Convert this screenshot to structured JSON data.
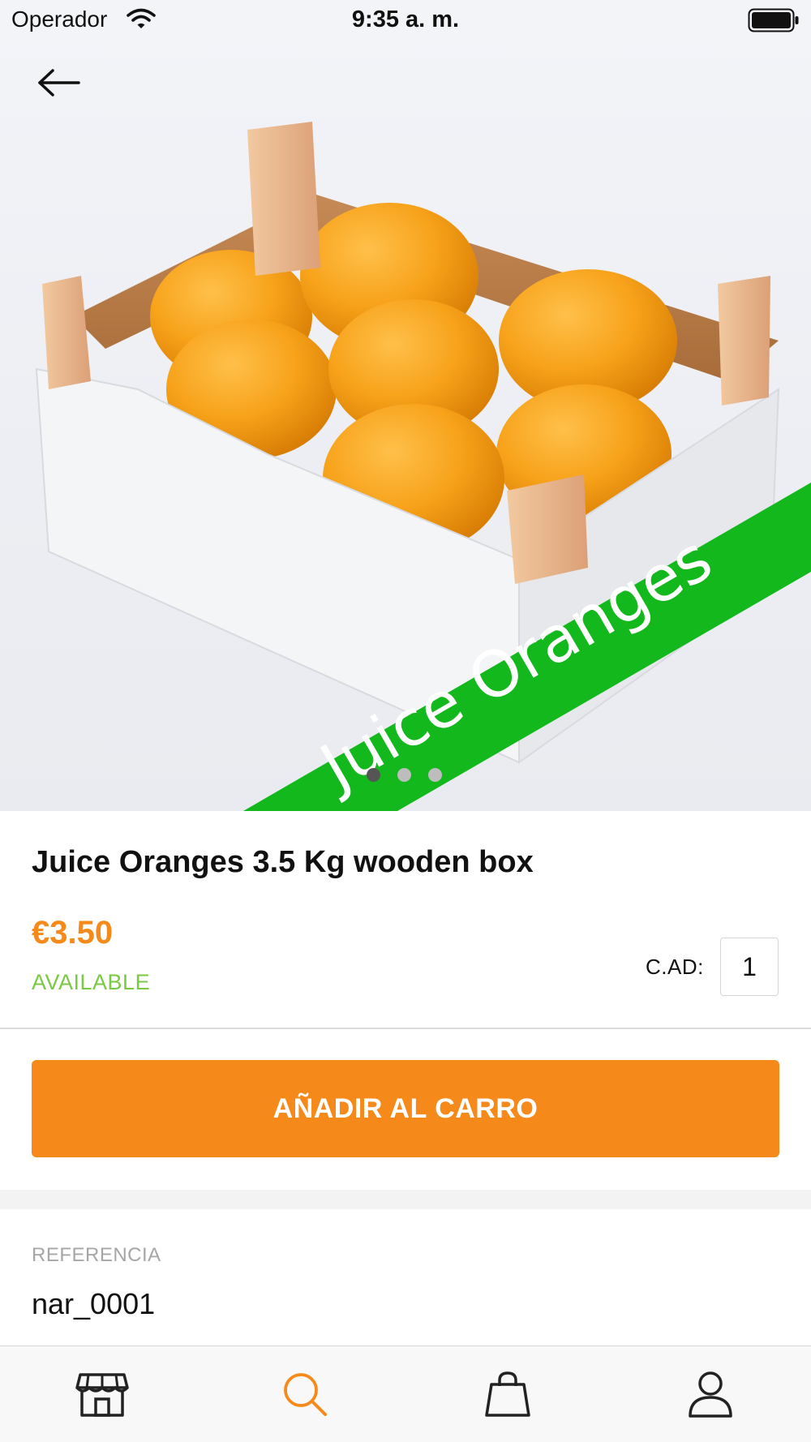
{
  "status_bar": {
    "carrier": "Operador",
    "time": "9:35 a. m."
  },
  "hero": {
    "banner_text": "Juice Oranges",
    "banner_color": "#12b81c",
    "image_pages": 3,
    "active_page": 1
  },
  "product": {
    "title": "Juice Oranges 3.5 Kg wooden box",
    "price": "€3.50",
    "availability": "AVAILABLE",
    "quantity_label": "C.AD:",
    "quantity_value": "1"
  },
  "actions": {
    "add_to_cart_label": "AÑADIR AL CARRO"
  },
  "reference": {
    "label": "REFERENCIA",
    "value": "nar_0001"
  },
  "tab_bar": {
    "items": [
      {
        "icon": "store-icon",
        "active": false
      },
      {
        "icon": "search-icon",
        "active": true
      },
      {
        "icon": "shopping-bag-icon",
        "active": false
      },
      {
        "icon": "user-icon",
        "active": false
      }
    ]
  },
  "colors": {
    "accent": "#f5891a",
    "available": "#7ac943",
    "icon_default": "#222222"
  }
}
